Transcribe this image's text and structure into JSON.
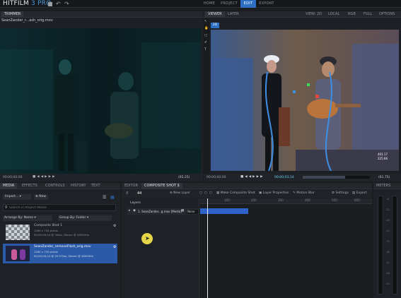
{
  "app": {
    "name": "HITFILM",
    "version": "3 PRO"
  },
  "menu": {
    "tabs": [
      "HOME",
      "PROJECT",
      "EDIT",
      "EXPORT"
    ],
    "active": "EDIT"
  },
  "trimmer": {
    "tab": "TRIMMER",
    "clip_name": "SeanZander_r...ash_orig.mov",
    "timecode": "00;00;00;00",
    "zoom": "(65.25)"
  },
  "viewer": {
    "tabs": [
      "VIEWER",
      "LAYER"
    ],
    "active_tab": "VIEWER",
    "mode_2d": "2D",
    "options": [
      "VIEW: 2D",
      "LOCAL",
      "RGB",
      "FULL",
      "OPTIONS"
    ],
    "timecode_left": "00;00;00;00",
    "timecode_mid": "00;00;03;14",
    "timecode_end": "00;00;09;24",
    "zoom": "(61.75)",
    "coord_x": "401.17",
    "coord_y": "225.66"
  },
  "media": {
    "tabs": [
      "MEDIA",
      "EFFECTS",
      "CONTROLS",
      "HISTORY",
      "TEXT"
    ],
    "active": "MEDIA",
    "import_label": "Import...",
    "new_label": "New",
    "search_placeholder": "Search in Project Media",
    "arrange_label": "Arrange By: Name",
    "group_label": "Group By: Folder",
    "items": [
      {
        "name": "Composite Shot 1",
        "line1": "1280 x 720 pixels",
        "line2": "00;00;09;24 @ 30fps, Stereo @ 48000Hz"
      },
      {
        "name": "SeanZander_removeFlash_orig.mov",
        "line1": "1280 x 720 pixels",
        "line2": "00;00;09;24 @ 29.97fps, Stereo @ 48000Hz"
      }
    ]
  },
  "editor": {
    "tabs": [
      "EDITOR",
      "COMPOSITE SHOT 1"
    ],
    "active": "COMPOSITE SHOT 1",
    "frame": "44",
    "buttons": [
      "New Layer",
      "Make Composite Shot",
      "Layer Properties",
      "Motion Blur",
      "Settings",
      "Export"
    ],
    "layers_header": "Layers",
    "layer": {
      "name": "1. SeanZander...g.mov [Media]",
      "blend": "None"
    },
    "ruler": [
      "100",
      "200",
      "300",
      "400",
      "500",
      "600",
      "700"
    ],
    "timecode": "00;00;00;00"
  },
  "meters": {
    "title": "METERS",
    "values": [
      "-6",
      "-12",
      "-18",
      "-24",
      "-30",
      "-36",
      "-42",
      "-48",
      "-54"
    ]
  },
  "colors": {
    "accent": "#2d6fc3",
    "clip": "#2e63c9"
  }
}
